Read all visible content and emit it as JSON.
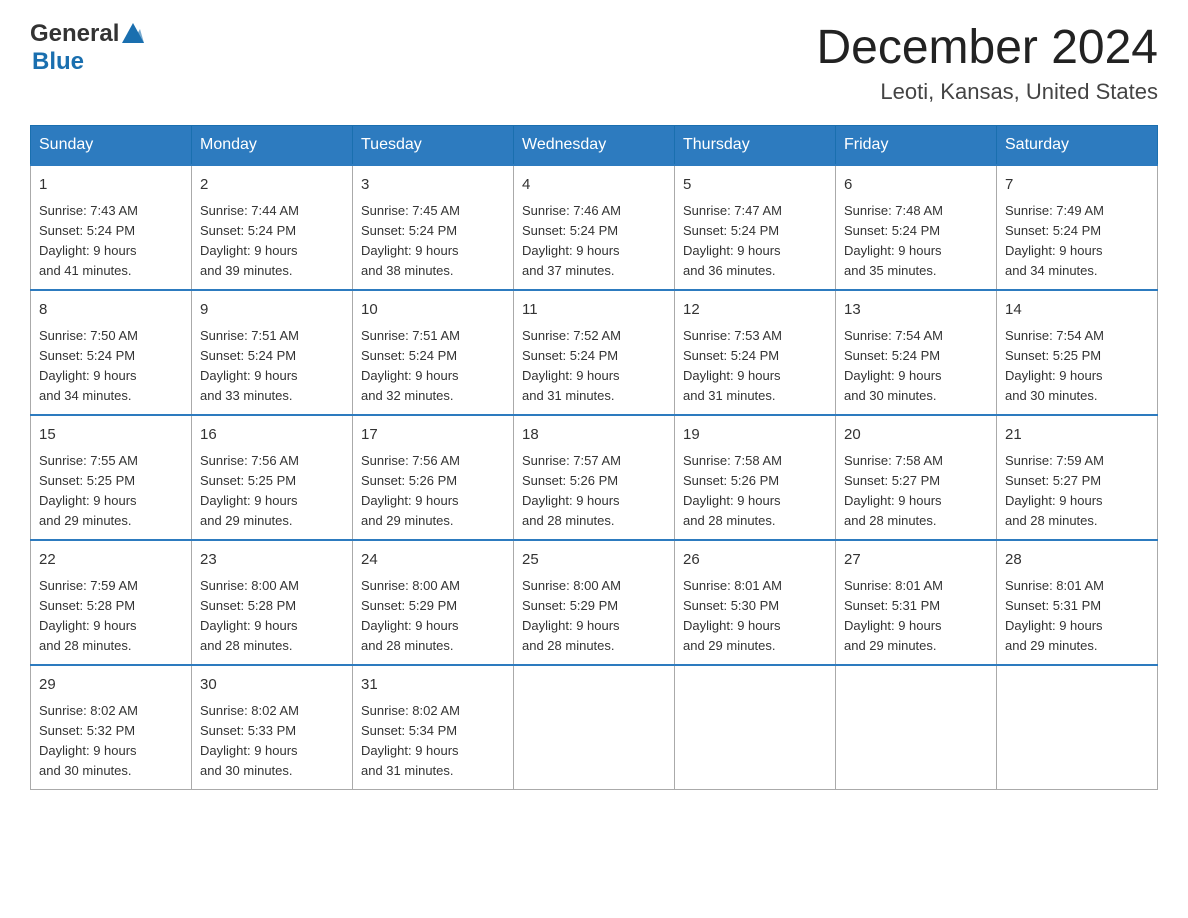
{
  "header": {
    "logo_general": "General",
    "logo_blue": "Blue",
    "month_title": "December 2024",
    "location": "Leoti, Kansas, United States"
  },
  "weekdays": [
    "Sunday",
    "Monday",
    "Tuesday",
    "Wednesday",
    "Thursday",
    "Friday",
    "Saturday"
  ],
  "weeks": [
    [
      {
        "day": "1",
        "sunrise": "7:43 AM",
        "sunset": "5:24 PM",
        "daylight": "9 hours and 41 minutes."
      },
      {
        "day": "2",
        "sunrise": "7:44 AM",
        "sunset": "5:24 PM",
        "daylight": "9 hours and 39 minutes."
      },
      {
        "day": "3",
        "sunrise": "7:45 AM",
        "sunset": "5:24 PM",
        "daylight": "9 hours and 38 minutes."
      },
      {
        "day": "4",
        "sunrise": "7:46 AM",
        "sunset": "5:24 PM",
        "daylight": "9 hours and 37 minutes."
      },
      {
        "day": "5",
        "sunrise": "7:47 AM",
        "sunset": "5:24 PM",
        "daylight": "9 hours and 36 minutes."
      },
      {
        "day": "6",
        "sunrise": "7:48 AM",
        "sunset": "5:24 PM",
        "daylight": "9 hours and 35 minutes."
      },
      {
        "day": "7",
        "sunrise": "7:49 AM",
        "sunset": "5:24 PM",
        "daylight": "9 hours and 34 minutes."
      }
    ],
    [
      {
        "day": "8",
        "sunrise": "7:50 AM",
        "sunset": "5:24 PM",
        "daylight": "9 hours and 34 minutes."
      },
      {
        "day": "9",
        "sunrise": "7:51 AM",
        "sunset": "5:24 PM",
        "daylight": "9 hours and 33 minutes."
      },
      {
        "day": "10",
        "sunrise": "7:51 AM",
        "sunset": "5:24 PM",
        "daylight": "9 hours and 32 minutes."
      },
      {
        "day": "11",
        "sunrise": "7:52 AM",
        "sunset": "5:24 PM",
        "daylight": "9 hours and 31 minutes."
      },
      {
        "day": "12",
        "sunrise": "7:53 AM",
        "sunset": "5:24 PM",
        "daylight": "9 hours and 31 minutes."
      },
      {
        "day": "13",
        "sunrise": "7:54 AM",
        "sunset": "5:24 PM",
        "daylight": "9 hours and 30 minutes."
      },
      {
        "day": "14",
        "sunrise": "7:54 AM",
        "sunset": "5:25 PM",
        "daylight": "9 hours and 30 minutes."
      }
    ],
    [
      {
        "day": "15",
        "sunrise": "7:55 AM",
        "sunset": "5:25 PM",
        "daylight": "9 hours and 29 minutes."
      },
      {
        "day": "16",
        "sunrise": "7:56 AM",
        "sunset": "5:25 PM",
        "daylight": "9 hours and 29 minutes."
      },
      {
        "day": "17",
        "sunrise": "7:56 AM",
        "sunset": "5:26 PM",
        "daylight": "9 hours and 29 minutes."
      },
      {
        "day": "18",
        "sunrise": "7:57 AM",
        "sunset": "5:26 PM",
        "daylight": "9 hours and 28 minutes."
      },
      {
        "day": "19",
        "sunrise": "7:58 AM",
        "sunset": "5:26 PM",
        "daylight": "9 hours and 28 minutes."
      },
      {
        "day": "20",
        "sunrise": "7:58 AM",
        "sunset": "5:27 PM",
        "daylight": "9 hours and 28 minutes."
      },
      {
        "day": "21",
        "sunrise": "7:59 AM",
        "sunset": "5:27 PM",
        "daylight": "9 hours and 28 minutes."
      }
    ],
    [
      {
        "day": "22",
        "sunrise": "7:59 AM",
        "sunset": "5:28 PM",
        "daylight": "9 hours and 28 minutes."
      },
      {
        "day": "23",
        "sunrise": "8:00 AM",
        "sunset": "5:28 PM",
        "daylight": "9 hours and 28 minutes."
      },
      {
        "day": "24",
        "sunrise": "8:00 AM",
        "sunset": "5:29 PM",
        "daylight": "9 hours and 28 minutes."
      },
      {
        "day": "25",
        "sunrise": "8:00 AM",
        "sunset": "5:29 PM",
        "daylight": "9 hours and 28 minutes."
      },
      {
        "day": "26",
        "sunrise": "8:01 AM",
        "sunset": "5:30 PM",
        "daylight": "9 hours and 29 minutes."
      },
      {
        "day": "27",
        "sunrise": "8:01 AM",
        "sunset": "5:31 PM",
        "daylight": "9 hours and 29 minutes."
      },
      {
        "day": "28",
        "sunrise": "8:01 AM",
        "sunset": "5:31 PM",
        "daylight": "9 hours and 29 minutes."
      }
    ],
    [
      {
        "day": "29",
        "sunrise": "8:02 AM",
        "sunset": "5:32 PM",
        "daylight": "9 hours and 30 minutes."
      },
      {
        "day": "30",
        "sunrise": "8:02 AM",
        "sunset": "5:33 PM",
        "daylight": "9 hours and 30 minutes."
      },
      {
        "day": "31",
        "sunrise": "8:02 AM",
        "sunset": "5:34 PM",
        "daylight": "9 hours and 31 minutes."
      },
      null,
      null,
      null,
      null
    ]
  ],
  "labels": {
    "sunrise": "Sunrise:",
    "sunset": "Sunset:",
    "daylight": "Daylight:"
  }
}
